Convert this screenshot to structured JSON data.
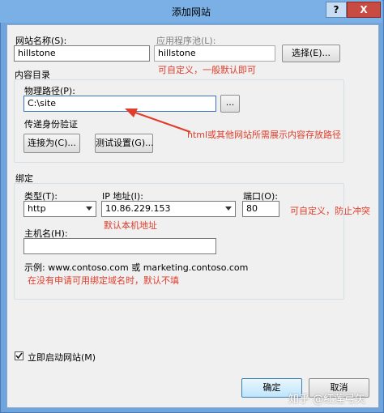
{
  "window": {
    "title": "添加网站",
    "help_label": "?",
    "close_label": "X"
  },
  "site": {
    "name_label": "网站名称(S):",
    "name_value": "hillstone",
    "pool_label": "应用程序池(L):",
    "pool_value": "hillstone",
    "select_button": "选择(E)..."
  },
  "content": {
    "section_label": "内容目录",
    "path_label": "物理路径(P):",
    "path_value": "C:\\site",
    "browse_button": "...",
    "auth_label": "传递身份验证",
    "connect_button": "连接为(C)...",
    "test_button": "测试设置(G)..."
  },
  "binding": {
    "section_label": "绑定",
    "type_label": "类型(T):",
    "type_value": "http",
    "ip_label": "IP 地址(I):",
    "ip_value": "10.86.229.153",
    "port_label": "端口(O):",
    "port_value": "80",
    "host_label": "主机名(H):",
    "host_value": "",
    "example_text": "示例: www.contoso.com 或 marketing.contoso.com"
  },
  "annotations": {
    "pool_note": "可自定义，一般默认即可",
    "path_note": "html或其他网站所需展示内容存放路径",
    "port_note": "可自定义，防止冲突",
    "ip_note": "默认本机地址",
    "host_note": "在没有申请可用绑定域名时，默认不填"
  },
  "footer": {
    "start_checkbox_label": "立即启动网站(M)",
    "start_checked": true,
    "ok_button": "确定",
    "cancel_button": "取消"
  },
  "watermark": "知乎 @红莲弓矢",
  "colors": {
    "annotation": "#e03d2a",
    "titlebar": "#7ab0e6",
    "close_button": "#c74b43"
  }
}
